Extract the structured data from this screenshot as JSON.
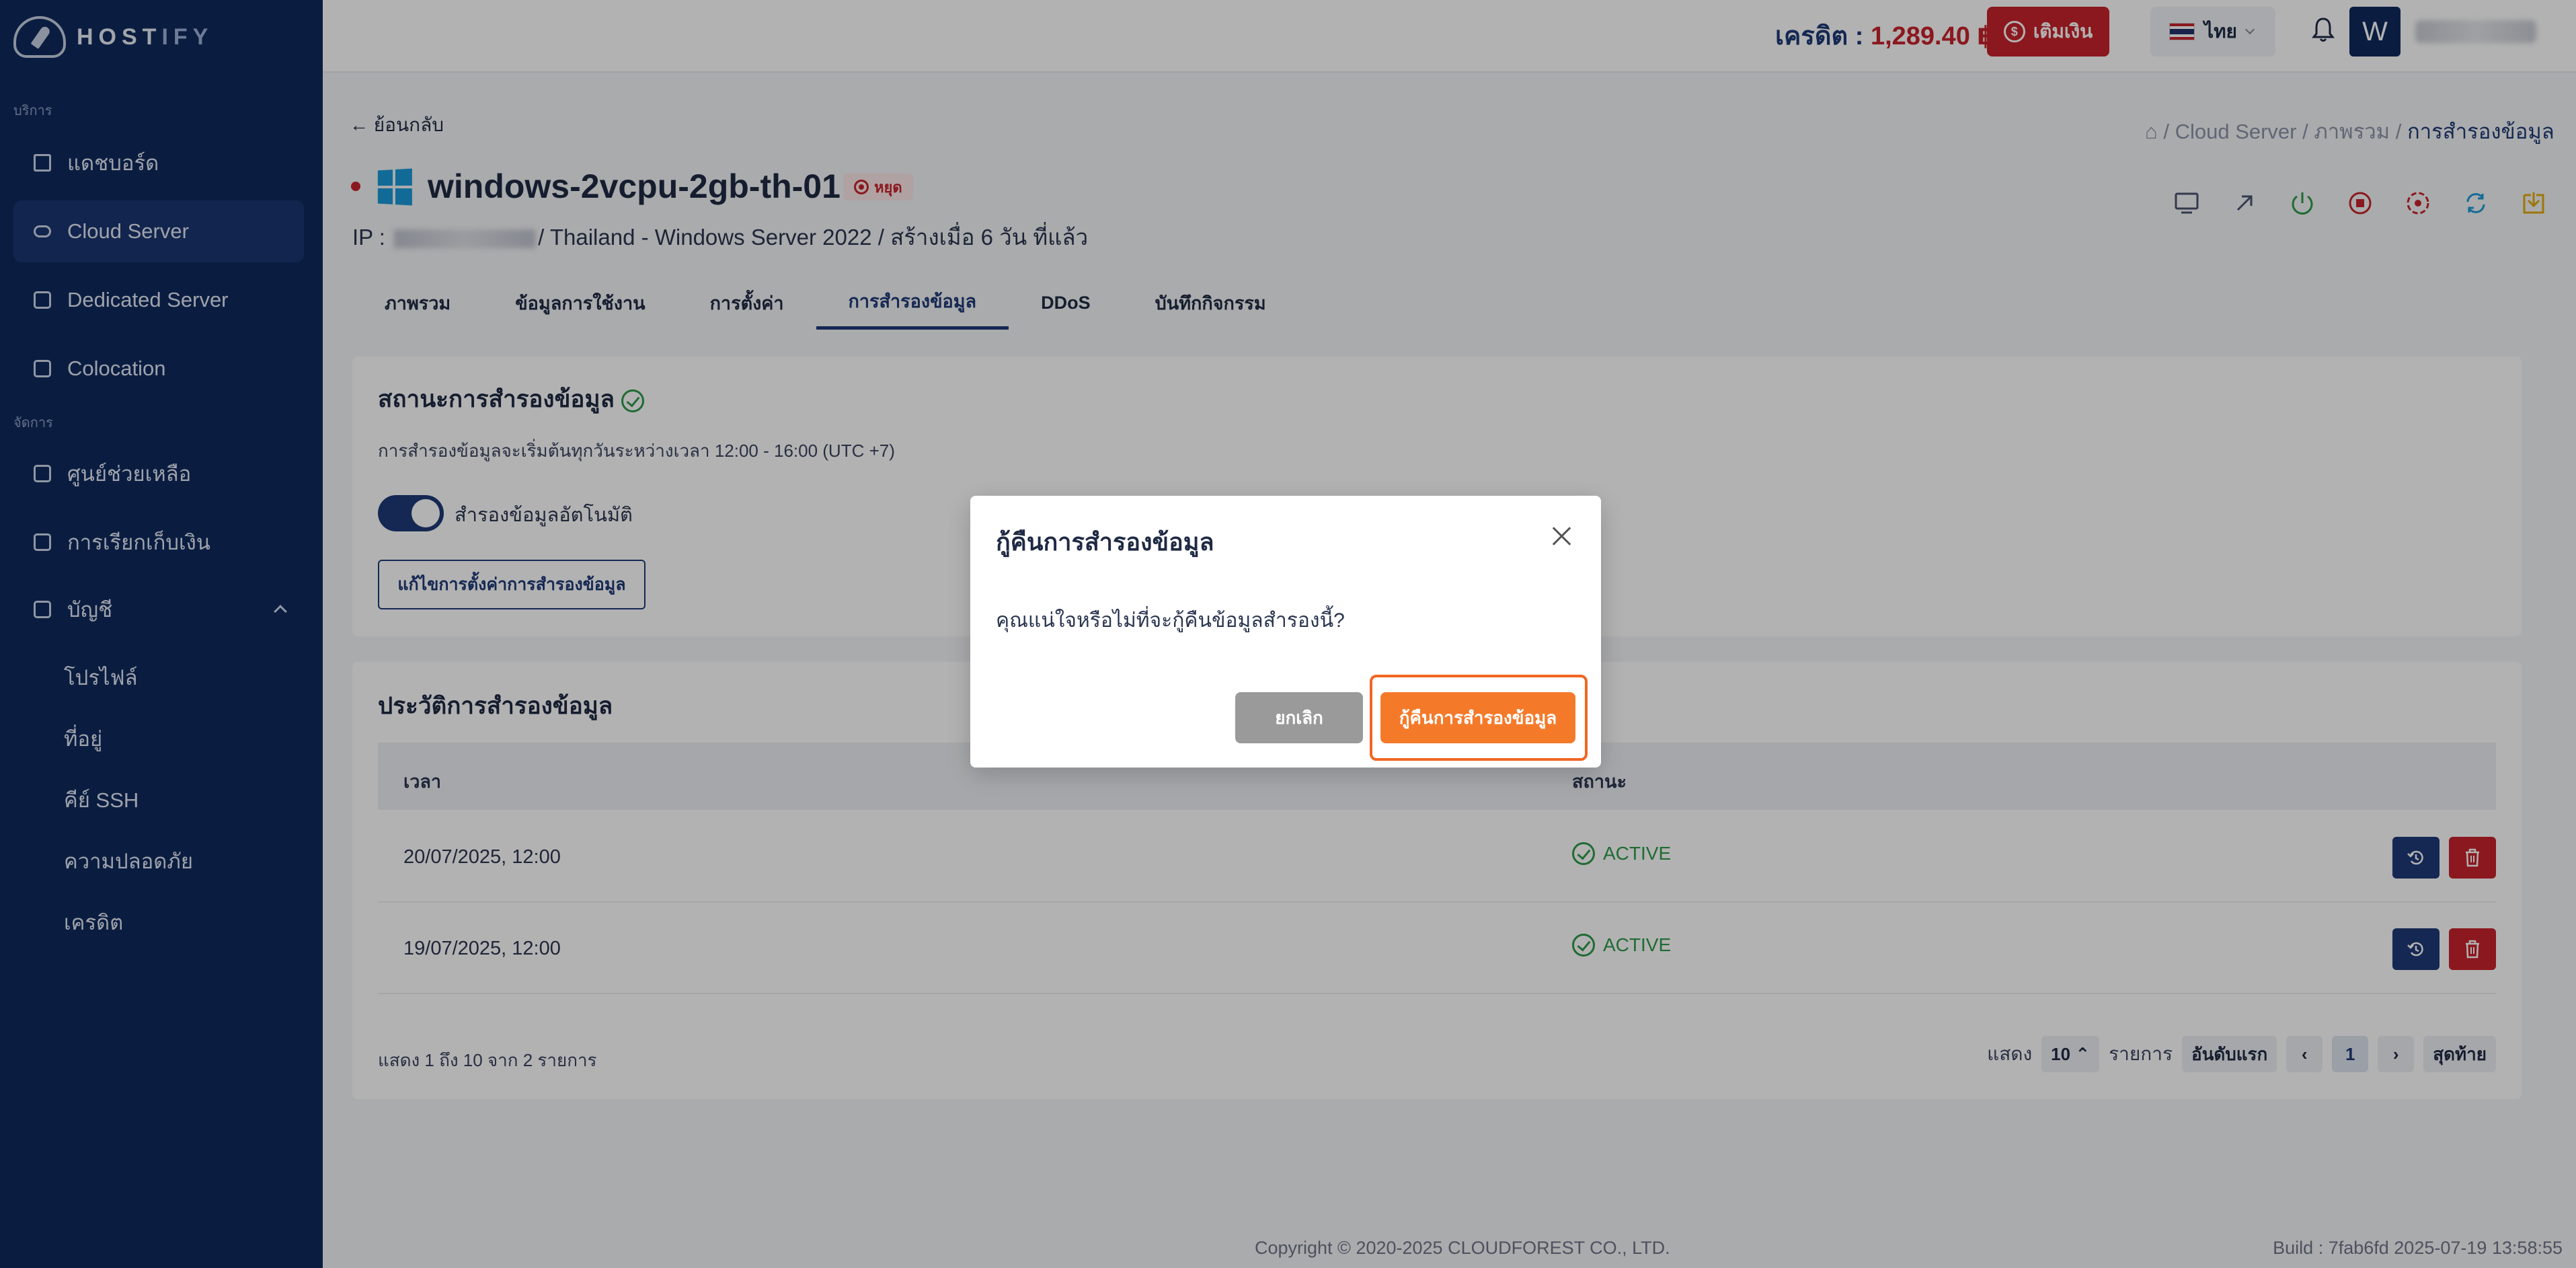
{
  "brand": {
    "name_main": "HOST",
    "name_accent": "IFY"
  },
  "sidebar": {
    "section_services": "บริการ",
    "section_manage": "จัดการ",
    "items": [
      {
        "label": "แดชบอร์ด",
        "icon": "home-icon"
      },
      {
        "label": "Cloud Server",
        "icon": "cloud-icon"
      },
      {
        "label": "Dedicated Server",
        "icon": "server-icon"
      },
      {
        "label": "Colocation",
        "icon": "rack-icon"
      },
      {
        "label": "ศูนย์ช่วยเหลือ",
        "icon": "help-icon"
      },
      {
        "label": "การเรียกเก็บเงิน",
        "icon": "billing-icon"
      },
      {
        "label": "บัญชี",
        "icon": "account-icon"
      }
    ],
    "account_sub": [
      "โปรไฟล์",
      "ที่อยู่",
      "คีย์ SSH",
      "ความปลอดภัย",
      "เครดิต"
    ]
  },
  "header": {
    "credit_label": "เครดิต : ",
    "credit_value": "1,289.40 ฿",
    "topup_label": "เติมเงิน",
    "language": "ไทย",
    "avatar_letter": "W"
  },
  "page": {
    "back_label": "← ย้อนกลับ",
    "breadcrumb": [
      "Cloud Server",
      "ภาพรวม",
      "การสำรองข้อมูล"
    ],
    "server_name": "windows-2vcpu-2gb-th-01",
    "status_badge": "หยุด",
    "ip_prefix": "IP : ",
    "ip_suffix": "/ Thailand - Windows Server 2022 / สร้างเมื่อ 6 วัน ที่แล้ว",
    "tabs": [
      "ภาพรวม",
      "ข้อมูลการใช้งาน",
      "การตั้งค่า",
      "การสำรองข้อมูล",
      "DDoS",
      "บันทึกกิจกรรม"
    ],
    "active_tab": "การสำรองข้อมูล"
  },
  "backup_status": {
    "title": "สถานะการสำรองข้อมูล",
    "note": "การสำรองข้อมูลจะเริ่มต้นทุกวันระหว่างเวลา 12:00 - 16:00 (UTC +7)",
    "toggle_label": "สำรองข้อมูลอัตโนมัติ",
    "toggle_on": true,
    "edit_button": "แก้ไขการตั้งค่าการสำรองข้อมูล"
  },
  "history": {
    "title": "ประวัติการสำรองข้อมูล",
    "columns": [
      "เวลา",
      "สถานะ"
    ],
    "rows": [
      {
        "time": "20/07/2025, 12:00",
        "status": "ACTIVE"
      },
      {
        "time": "19/07/2025, 12:00",
        "status": "ACTIVE"
      }
    ],
    "page_info": "แสดง 1 ถึง 10 จาก 2 รายการ",
    "show_label": "แสดง",
    "per_page": "10",
    "items_label": "รายการ",
    "first_label": "อันดับแรก",
    "current_page": "1",
    "last_label": "สุดท้าย"
  },
  "modal": {
    "title": "กู้คืนการสำรองข้อมูล",
    "body": "คุณแน่ใจหรือไม่ที่จะกู้คืนข้อมูลสำรองนี้?",
    "cancel": "ยกเลิก",
    "confirm": "กู้คืนการสำรองข้อมูล"
  },
  "footer": {
    "copyright": "Copyright © 2020-2025 CLOUDFOREST CO., LTD.",
    "build": "Build : 7fab6fd 2025-07-19 13:58:55"
  },
  "colors": {
    "sidebar_bg": "#0f2a5e",
    "primary": "#1f3a78",
    "danger": "#c8232c",
    "success": "#2e9a4a",
    "confirm_orange": "#f47a2a"
  }
}
